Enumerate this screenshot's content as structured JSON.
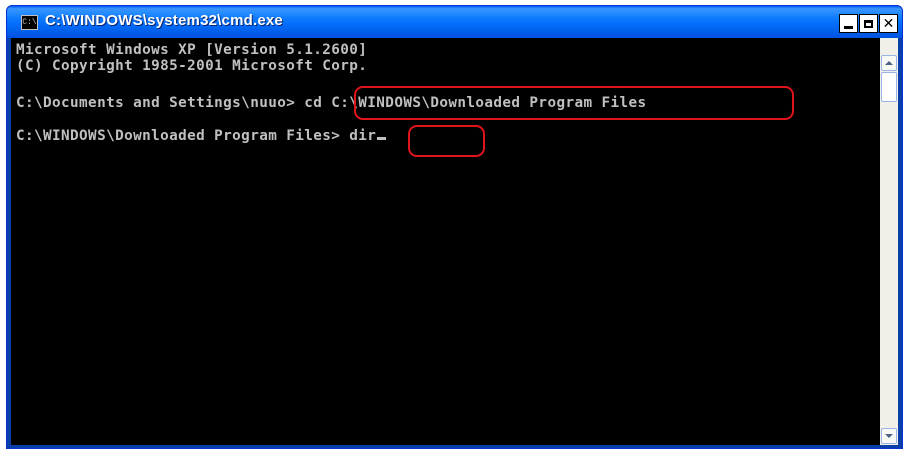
{
  "window": {
    "title": "C:\\WINDOWS\\system32\\cmd.exe",
    "icon": "cmd-app-icon",
    "icon_text": "C:\\",
    "buttons": {
      "minimize": "minimize-icon",
      "maximize": "maximize-icon",
      "close": "close-icon",
      "close_glyph": "✕"
    }
  },
  "console": {
    "lines": [
      "Microsoft Windows XP [Version 5.1.2600]",
      "(C) Copyright 1985-2001 Microsoft Corp.",
      "C:\\Documents and Settings\\nuuo> cd C:\\WINDOWS\\Downloaded Program Files",
      "C:\\WINDOWS\\Downloaded Program Files> dir"
    ],
    "text_color": "#c0c0c0",
    "background": "#000000"
  },
  "highlights": {
    "color": "#e0151b",
    "targets": [
      "cd C:\\WINDOWS\\Downloaded Program Files",
      "dir"
    ]
  },
  "colors": {
    "titlebar": "#0054e3",
    "title_text": "#ffffff"
  }
}
